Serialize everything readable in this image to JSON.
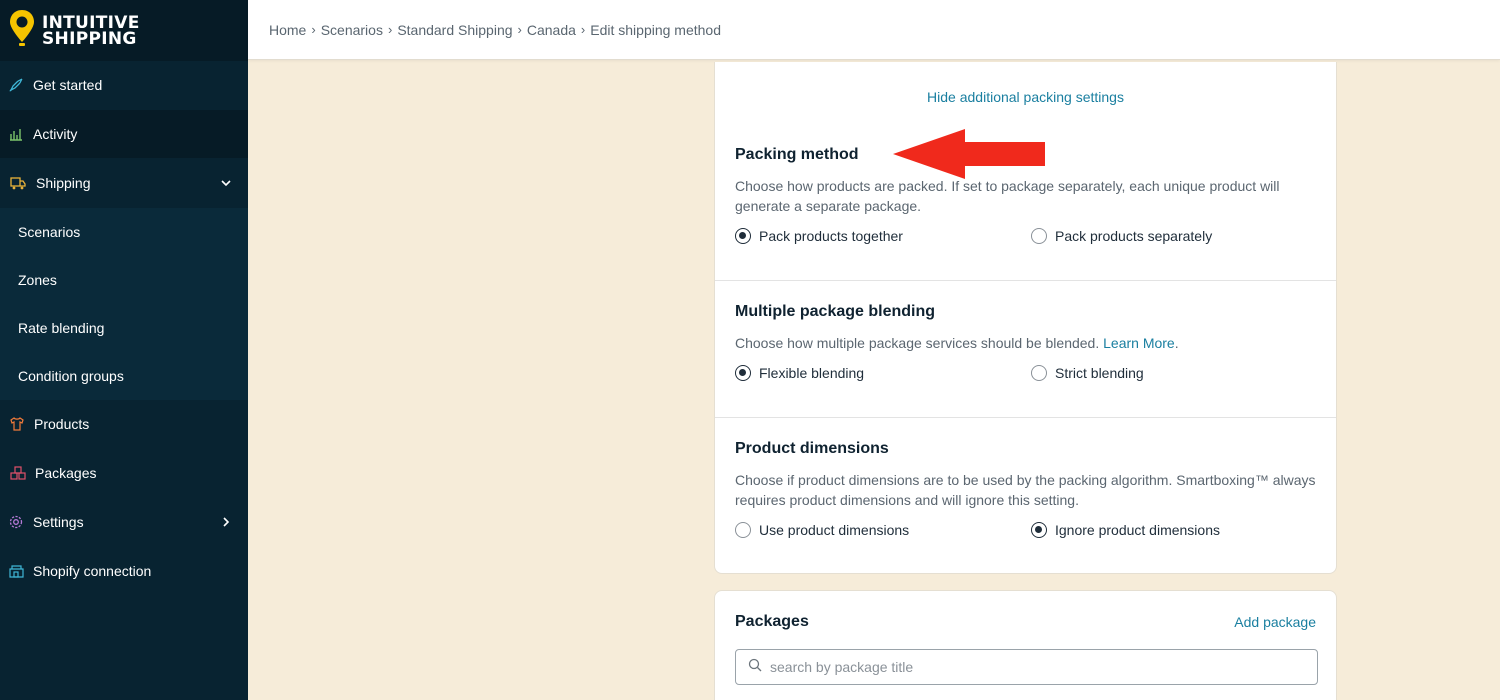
{
  "brand": {
    "line1": "INTUITIVE",
    "line2": "SHIPPING"
  },
  "sidebar": {
    "items": [
      {
        "label": "Get started",
        "icon": "rocket-icon"
      },
      {
        "label": "Activity",
        "icon": "chart-icon"
      },
      {
        "label": "Shipping",
        "icon": "truck-icon"
      },
      {
        "label": "Scenarios"
      },
      {
        "label": "Zones"
      },
      {
        "label": "Rate blending"
      },
      {
        "label": "Condition groups"
      },
      {
        "label": "Products",
        "icon": "shirt-icon"
      },
      {
        "label": "Packages",
        "icon": "boxes-icon"
      },
      {
        "label": "Settings",
        "icon": "gear-icon"
      },
      {
        "label": "Shopify connection",
        "icon": "store-icon"
      }
    ]
  },
  "breadcrumb": [
    "Home",
    "Scenarios",
    "Standard Shipping",
    "Canada",
    "Edit shipping method"
  ],
  "card": {
    "hide_link": "Hide additional packing settings",
    "packing": {
      "title": "Packing method",
      "desc": "Choose how products are packed. If set to package separately, each unique product will generate a separate package.",
      "opt1": "Pack products together",
      "opt2": "Pack products separately"
    },
    "blending": {
      "title": "Multiple package blending",
      "desc": "Choose how multiple package services should be blended.",
      "learn_more": "Learn More",
      "period": ".",
      "opt1": "Flexible blending",
      "opt2": "Strict blending"
    },
    "dimensions": {
      "title": "Product dimensions",
      "desc": "Choose if product dimensions are to be used by the packing algorithm. Smartboxing™ always requires product dimensions and will ignore this setting.",
      "opt1": "Use product dimensions",
      "opt2": "Ignore product dimensions"
    }
  },
  "packages": {
    "title": "Packages",
    "add_label": "Add package",
    "search_placeholder": "search by package title"
  },
  "colors": {
    "sidebar": "#082331",
    "accent": "#1a7fa0",
    "background": "#f6ecd9",
    "annotation": "#f0291c",
    "logo": "#f5c400"
  }
}
